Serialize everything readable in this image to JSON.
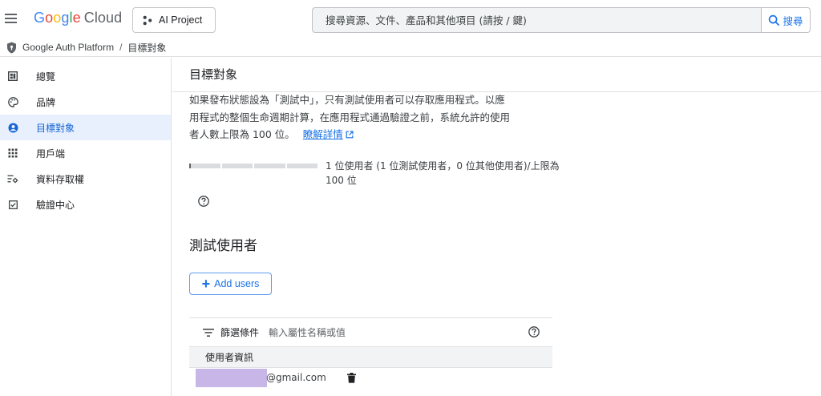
{
  "topbar": {
    "logo_letters": [
      "G",
      "o",
      "o",
      "g",
      "l",
      "e"
    ],
    "logo_cloud": "Cloud",
    "project_name": "AI Project",
    "search_placeholder": "搜尋資源、文件、產品和其他項目 (請按 / 鍵)",
    "search_button": "搜尋"
  },
  "breadcrumb": {
    "root": "Google Auth Platform",
    "separator": "/",
    "current": "目標對象"
  },
  "sidebar": {
    "items": [
      {
        "label": "總覽",
        "icon": "dashboard-icon"
      },
      {
        "label": "品牌",
        "icon": "palette-icon"
      },
      {
        "label": "目標對象",
        "icon": "person-icon",
        "active": true
      },
      {
        "label": "用戶端",
        "icon": "apps-icon"
      },
      {
        "label": "資料存取權",
        "icon": "data-access-icon"
      },
      {
        "label": "驗證中心",
        "icon": "checkbox-icon"
      }
    ]
  },
  "main": {
    "title": "目標對象",
    "description_line1": "如果發布狀態設為「測試中」，只有測試使用者可以存取應用程式。以應",
    "description_line2": "用程式的整個生命週期計算，在應用程式通過驗證之前，系統允許的使用",
    "description_line3": "者人數上限為 100 位。",
    "learn_more": "瞭解詳情",
    "usage_text": "1 位使用者 (1 位測試使用者，0 位其他使用者)/上限為 100 位",
    "usage_fraction": 0.01,
    "test_users_title": "測試使用者",
    "add_users_button": "Add users",
    "filter_label": "篩選條件",
    "filter_placeholder": "輸入屬性名稱或值",
    "table_header": "使用者資訊",
    "rows": [
      {
        "email_suffix": "@gmail.com"
      }
    ]
  },
  "colors": {
    "accent": "#1a73e8",
    "active_bg": "#e8f0fe",
    "redaction": "#c9b6e8"
  }
}
